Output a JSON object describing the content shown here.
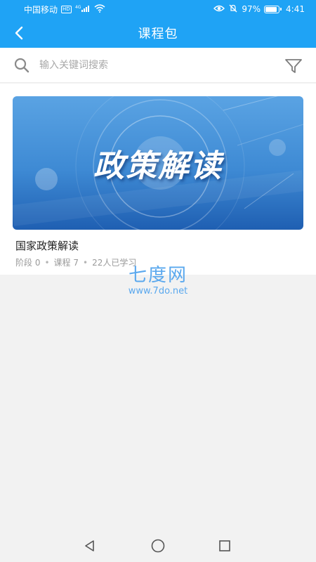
{
  "status_bar": {
    "carrier": "中国移动",
    "hd_badge": "HD",
    "network": "4G",
    "battery": "97%",
    "time": "4:41",
    "icons": [
      "signal-icon",
      "wifi-icon",
      "eye-icon",
      "mute-icon",
      "battery-icon"
    ]
  },
  "header": {
    "title": "课程包",
    "back_icon": "chevron-left-icon"
  },
  "search": {
    "placeholder": "输入关键词搜索",
    "value": "",
    "search_icon": "search-icon",
    "filter_icon": "filter-icon"
  },
  "courses": [
    {
      "cover_text": "政策解读",
      "title": "国家政策解读",
      "stage_label": "阶段 0",
      "course_label": "课程 7",
      "learners_label": "22人已学习",
      "separator": "•"
    }
  ],
  "watermark": {
    "logo": "七度网",
    "url": "www.7do.net"
  },
  "nav": {
    "icons": [
      "back-triangle-icon",
      "home-circle-icon",
      "recents-square-icon"
    ]
  },
  "colors": {
    "primary": "#1fa3f5",
    "background": "#f2f2f2",
    "card": "#ffffff",
    "muted_text": "#9a9a9a"
  }
}
